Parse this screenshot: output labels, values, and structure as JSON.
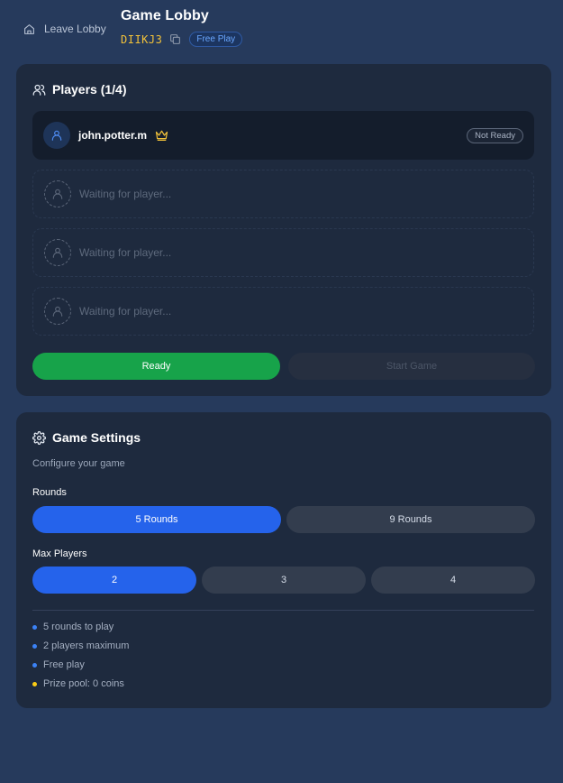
{
  "header": {
    "leave_label": "Leave Lobby",
    "title": "Game Lobby",
    "lobby_code": "DIIKJ3",
    "mode_badge": "Free Play"
  },
  "players": {
    "title": "Players (1/4)",
    "list": [
      {
        "name": "john.potter.m",
        "is_host": true,
        "status": "Not Ready"
      }
    ],
    "waiting_text": "Waiting for player...",
    "ready_label": "Ready",
    "start_label": "Start Game"
  },
  "settings": {
    "title": "Game Settings",
    "subtitle": "Configure your game",
    "rounds_label": "Rounds",
    "rounds_options": [
      "5 Rounds",
      "9 Rounds"
    ],
    "rounds_selected": "5 Rounds",
    "max_players_label": "Max Players",
    "max_players_options": [
      "2",
      "3",
      "4"
    ],
    "max_players_selected": "2",
    "summary": [
      {
        "text": "5 rounds to play",
        "color": "#3b82f6"
      },
      {
        "text": "2 players maximum",
        "color": "#3b82f6"
      },
      {
        "text": "Free play",
        "color": "#3b82f6"
      },
      {
        "text": "Prize pool: 0 coins",
        "color": "#facc15"
      }
    ]
  },
  "colors": {
    "background": "#263a5c",
    "card": "#1e2a3e",
    "accent": "#2563eb",
    "ready": "#17a34a",
    "code": "#f2c23a",
    "crown": "#f2c23a"
  },
  "icons": [
    "home-icon",
    "copy-icon",
    "users-icon",
    "user-icon",
    "crown-icon",
    "gear-icon"
  ]
}
